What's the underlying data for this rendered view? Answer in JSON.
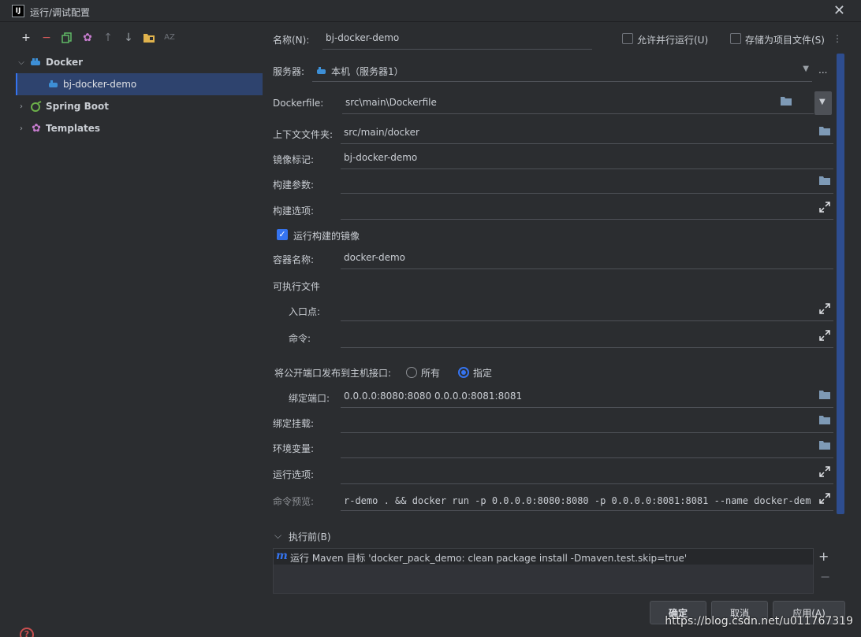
{
  "window": {
    "title": "运行/调试配置",
    "icon_label": "IJ"
  },
  "toolbar": {
    "icons": [
      "add-icon",
      "remove-icon",
      "copy-icon",
      "settings-icon",
      "move-up-icon",
      "move-down-icon",
      "folder-icon",
      "sort-icon"
    ]
  },
  "tree": {
    "docker": "Docker",
    "docker_child": "bj-docker-demo",
    "spring_boot": "Spring Boot",
    "templates": "Templates"
  },
  "form": {
    "name_label": "名称(N):",
    "name_value": "bj-docker-demo",
    "allow_parallel": "允许并行运行(U)",
    "store_as_file": "存储为项目文件(S)",
    "server_label": "服务器:",
    "server_value": "本机（服务器1）",
    "more": "...",
    "dockerfile_label": "Dockerfile:",
    "dockerfile_value": "src\\main\\Dockerfile",
    "context_label": "上下文文件夹:",
    "context_value": "src/main/docker",
    "image_tag_label": "镜像标记:",
    "image_tag_value": "bj-docker-demo",
    "build_args_label": "构建参数:",
    "build_opts_label": "构建选项:",
    "run_built_image": "运行构建的镜像",
    "container_name_label": "容器名称:",
    "container_name_value": "docker-demo",
    "executable_section": "可执行文件",
    "entrypoint_label": "入口点:",
    "command_label": "命令:",
    "publish_ports_label": "将公开端口发布到主机接口:",
    "radio_all": "所有",
    "radio_specified": "指定",
    "bind_ports_label": "绑定端口:",
    "bind_ports_value": "0.0.0.0:8080:8080 0.0.0.0:8081:8081",
    "bind_mounts_label": "绑定挂载:",
    "env_vars_label": "环境变量:",
    "run_opts_label": "运行选项:",
    "cmd_preview_label": "命令预览:",
    "cmd_preview_value": "r-demo . && docker run -p 0.0.0.0:8080:8080 -p 0.0.0.0:8081:8081 --name docker-demo bj-docker-demo",
    "before_launch_label": "执行前(B)",
    "before_launch_item": "运行 Maven 目标 'docker_pack_demo: clean package install -Dmaven.test.skip=true'"
  },
  "buttons": {
    "ok": "确定",
    "cancel": "取消",
    "apply": "应用(A)"
  },
  "watermark": "https://blog.csdn.net/u011767319",
  "colors": {
    "accent": "#3574f0",
    "background": "#2b2d30",
    "selection": "#2e436e"
  }
}
